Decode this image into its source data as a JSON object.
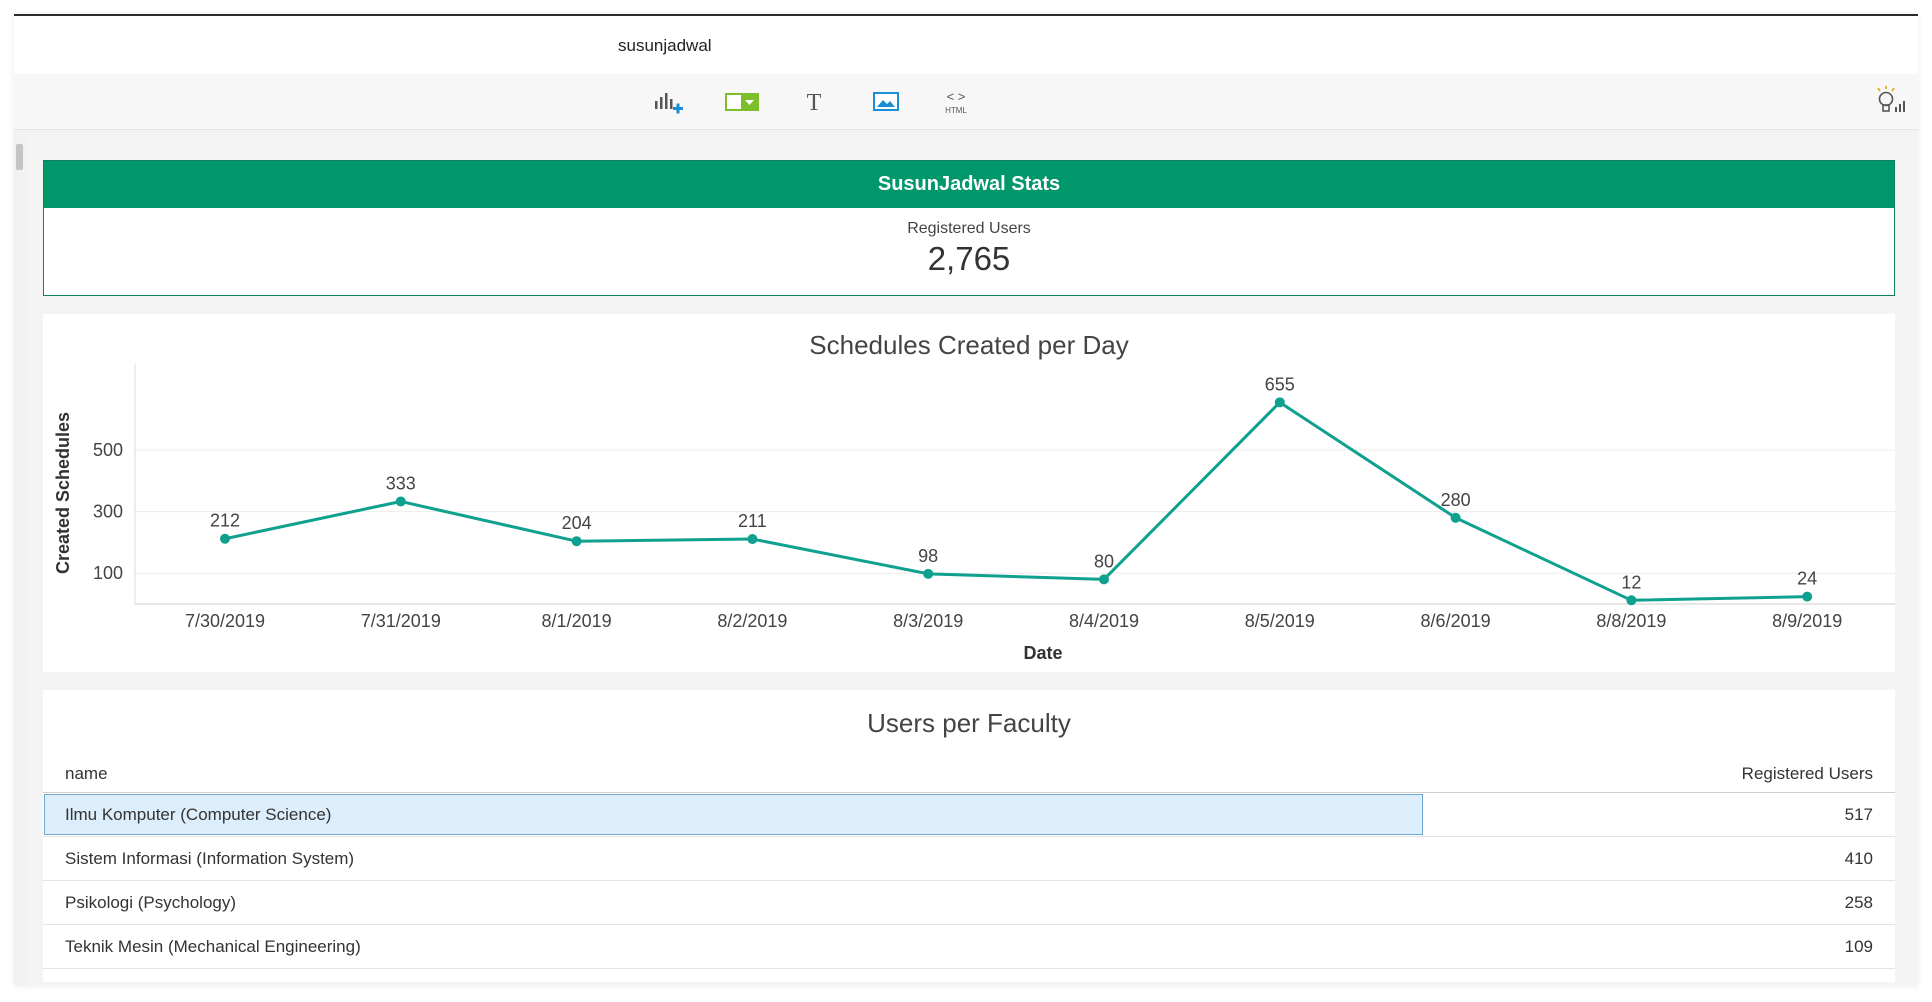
{
  "window": {
    "title": "susunjadwal"
  },
  "toolbar": {
    "buttons": [
      {
        "name": "add-chart-button",
        "icon": "bar-chart-plus-icon"
      },
      {
        "name": "add-filter-button",
        "icon": "filter-dropdown-icon"
      },
      {
        "name": "add-text-button",
        "icon": "text-icon",
        "glyph": "T"
      },
      {
        "name": "add-image-button",
        "icon": "image-icon"
      },
      {
        "name": "add-html-button",
        "icon": "html-code-icon",
        "glyph": "< >",
        "sublabel": "HTML"
      }
    ],
    "right_icon": "lightbulb-insights-icon"
  },
  "colors": {
    "header_green": "#00986b",
    "line": "#0fa08f",
    "highlight": "#dceefb"
  },
  "stats": {
    "title": "SusunJadwal Stats",
    "label": "Registered Users",
    "value": "2,765"
  },
  "chart_data": {
    "type": "line",
    "title": "Schedules Created per Day",
    "xlabel": "Date",
    "ylabel": "Created Schedules",
    "categories": [
      "7/30/2019",
      "7/31/2019",
      "8/1/2019",
      "8/2/2019",
      "8/3/2019",
      "8/4/2019",
      "8/5/2019",
      "8/6/2019",
      "8/8/2019",
      "8/9/2019"
    ],
    "values": [
      212,
      333,
      204,
      211,
      98,
      80,
      655,
      280,
      12,
      24
    ],
    "y_ticks": [
      100,
      300,
      500
    ],
    "ylim": [
      0,
      760
    ],
    "grid": true
  },
  "table": {
    "title": "Users per Faculty",
    "columns": [
      "name",
      "Registered Users"
    ],
    "rows": [
      {
        "name": "Ilmu Komputer (Computer Science)",
        "value": "517",
        "selected": true
      },
      {
        "name": "Sistem Informasi (Information System)",
        "value": "410",
        "selected": false
      },
      {
        "name": "Psikologi (Psychology)",
        "value": "258",
        "selected": false
      },
      {
        "name": "Teknik Mesin (Mechanical Engineering)",
        "value": "109",
        "selected": false
      }
    ]
  }
}
